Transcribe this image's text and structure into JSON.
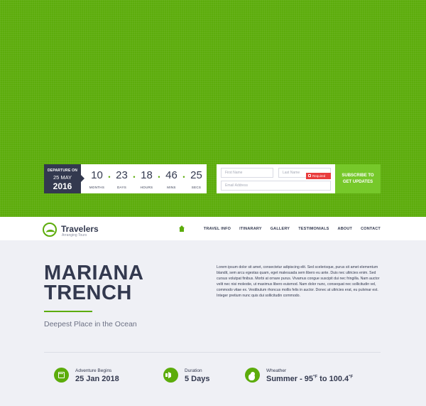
{
  "countdown": {
    "departure_label": "DEPARTURE ON",
    "departure_day": "25 MAY",
    "departure_year": "2016",
    "units": [
      {
        "value": "10",
        "label": "MONTHS"
      },
      {
        "value": "23",
        "label": "DAYS"
      },
      {
        "value": "18",
        "label": "HOURS"
      },
      {
        "value": "46",
        "label": "MINS"
      },
      {
        "value": "25",
        "label": "SECS"
      }
    ]
  },
  "subscribe": {
    "first_name_placeholder": "First Name",
    "last_name_placeholder": "Last Name",
    "email_placeholder": "Email Address",
    "required_label": "Required",
    "button_line1": "SUBSCRIBE TO",
    "button_line2": "GET UPDATES"
  },
  "brand": {
    "name": "Travelers",
    "tagline": "Arranging Tours"
  },
  "nav": {
    "items": [
      "TRAVEL INFO",
      "ITINARARY",
      "GALLERY",
      "TESTIMONIALS",
      "ABOUT",
      "CONTACT"
    ]
  },
  "hero": {
    "title_line1": "MARIANA",
    "title_line2": "TRENCH",
    "subtitle": "Deepest Place in the Ocean",
    "description": "Lorem ipsum dolor sit amet, consectetur adipiscing elit. Sed scelerisque, purus sit amet elementum blandit, sem arcu egestas quam, eget malesuada sem libero eu ante. Duis nec ultricies enim. Sed cursus volutpat finibus. Morbi at ornare purus. Vivamus congue suscipit dui nec fringilla. Nam auctor velit nec nisi molestie, ut maximus libero euismod. Nam dolor nunc, consequat nec sollicitudin vel, commodo vitae ex. Vestibulum rhoncus mollis felis in auctor. Donec at ultricies erat, eu pulvinar est. Integer pretium nunc quis dui sollicitudin commodo."
  },
  "facts": [
    {
      "label": "Adventure Begins",
      "value": "25 Jan 2018"
    },
    {
      "label": "Duration",
      "value": "5 Days"
    },
    {
      "label": "Wheather",
      "value_prefix": "Summer - 95",
      "unit": "°F",
      "value_mid": " to 100.4",
      "unit2": "°F"
    }
  ],
  "colors": {
    "accent": "#5cac0b",
    "button": "#76c82a",
    "dark": "#33394f",
    "required": "#e93d3d",
    "background": "#eff0f5"
  }
}
